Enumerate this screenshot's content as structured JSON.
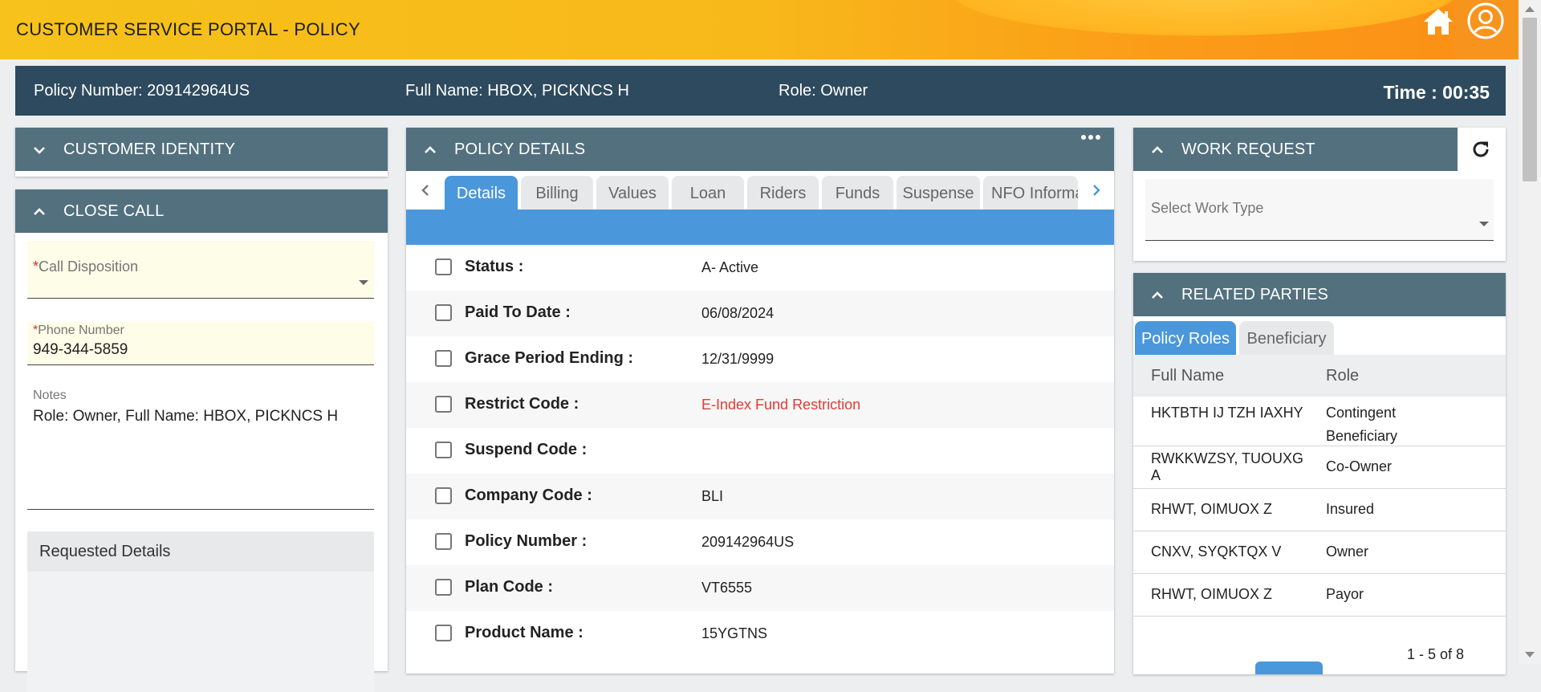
{
  "header": {
    "title": "CUSTOMER SERVICE PORTAL - POLICY",
    "home_icon": "home-icon",
    "user_icon": "user-circle-icon"
  },
  "info_bar": {
    "policy_number": "Policy Number: 209142964US",
    "full_name": "Full Name: HBOX, PICKNCS H",
    "role": "Role: Owner",
    "time": "Time : 00:35"
  },
  "customer_identity": {
    "title": "CUSTOMER IDENTITY"
  },
  "close_call": {
    "title": "CLOSE CALL",
    "call_disposition": {
      "required_mark": "*",
      "label": "Call Disposition",
      "value": ""
    },
    "phone_number": {
      "required_mark": "*",
      "label": "Phone Number",
      "value": "949-344-5859"
    },
    "notes": {
      "label": "Notes",
      "value": "Role: Owner, Full Name: HBOX, PICKNCS H"
    },
    "requested_details": {
      "title": "Requested Details"
    }
  },
  "policy_details": {
    "title": "POLICY DETAILS",
    "more_icon": "more-horizontal-icon",
    "tabs": [
      "Details",
      "Billing",
      "Values",
      "Loan",
      "Riders",
      "Funds",
      "Suspense",
      "NFO Informa"
    ],
    "active_tab": "Details",
    "rows": [
      {
        "label": "Status",
        "colon": ":",
        "value": "A- Active"
      },
      {
        "label": "Paid To Date",
        "colon": ":",
        "value": "06/08/2024"
      },
      {
        "label": "Grace Period Ending",
        "colon": ":",
        "value": "12/31/9999"
      },
      {
        "label": "Restrict Code",
        "colon": ":",
        "value": "E-Index Fund Restriction"
      },
      {
        "label": "Suspend Code",
        "colon": ":",
        "value": ""
      },
      {
        "label": "Company Code",
        "colon": ":",
        "value": "BLI"
      },
      {
        "label": "Policy Number",
        "colon": ":",
        "value": "209142964US"
      },
      {
        "label": "Plan Code",
        "colon": ":",
        "value": "VT6555"
      },
      {
        "label": "Product Name",
        "colon": ":",
        "value": "15YGTNS"
      }
    ]
  },
  "work_request": {
    "title": "WORK REQUEST",
    "refresh_icon": "refresh-icon",
    "select_placeholder": "Select Work Type"
  },
  "related_parties": {
    "title": "RELATED PARTIES",
    "tabs": [
      "Policy Roles",
      "Beneficiary"
    ],
    "active_tab": "Policy Roles",
    "columns": [
      "Full Name",
      "Role"
    ],
    "rows": [
      {
        "name": "HKTBTH IJ TZH IAXHY",
        "role": "Contingent Beneficiary"
      },
      {
        "name": "RWKKWZSY, TUOUXG A",
        "role": "Co-Owner"
      },
      {
        "name": "RHWT, OIMUOX Z",
        "role": "Insured"
      },
      {
        "name": "CNXV, SYQKTQX V",
        "role": "Owner"
      },
      {
        "name": "RHWT, OIMUOX Z",
        "role": "Payor"
      }
    ],
    "pagination": "1 - 5 of 8"
  },
  "colors": {
    "header_gradient_start": "#f6c21b",
    "header_gradient_end": "#fb8f16",
    "info_bar": "#2e4a5e",
    "panel_header": "#53707f",
    "active_tab": "#4a97dc",
    "required_field_bg": "#fdfde8",
    "restriction_text": "#e53935"
  }
}
